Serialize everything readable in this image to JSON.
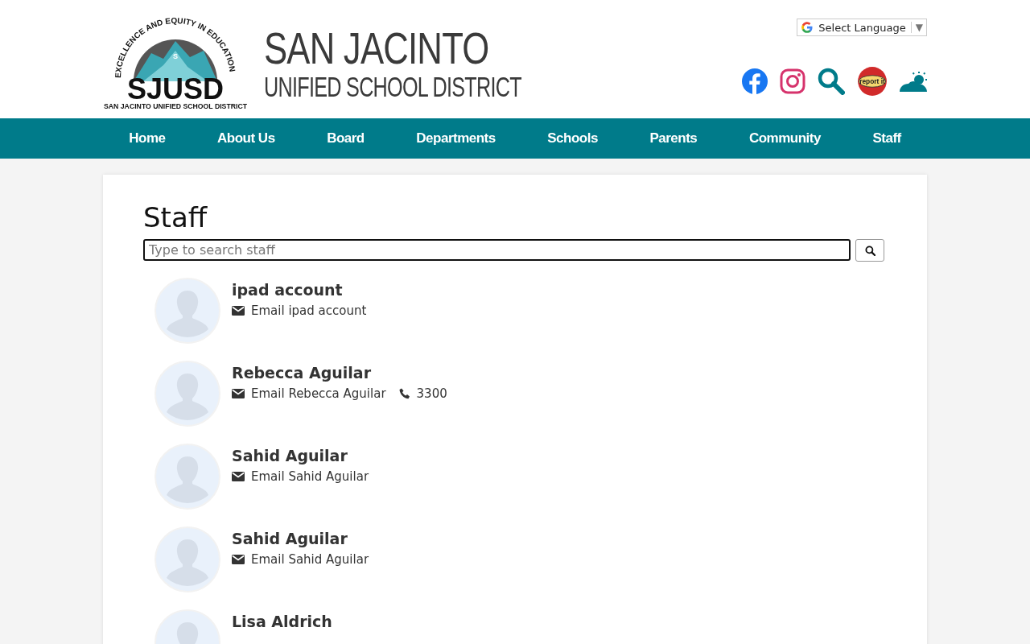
{
  "header": {
    "logo": {
      "arc_text": "EXCELLENCE AND EQUITY IN EDUCATION",
      "badge": "S",
      "wordmark": "SJUSD",
      "subtitle": "SAN JACINTO UNIFIED SCHOOL DISTRICT"
    },
    "title": "SAN JACINTO",
    "subtitle": "UNIFIED SCHOOL DISTRICT",
    "language": "Select Language",
    "language_caret": "▼",
    "report_label": "report it"
  },
  "nav": [
    {
      "label": "Home"
    },
    {
      "label": "About Us"
    },
    {
      "label": "Board"
    },
    {
      "label": "Departments"
    },
    {
      "label": "Schools"
    },
    {
      "label": "Parents"
    },
    {
      "label": "Community"
    },
    {
      "label": "Staff"
    }
  ],
  "page": {
    "title": "Staff",
    "search": {
      "placeholder": "Type to search staff"
    }
  },
  "staff": [
    {
      "name": "ipad account",
      "email": "Email ipad account"
    },
    {
      "name": "Rebecca Aguilar",
      "email": "Email Rebecca Aguilar",
      "phone": "3300"
    },
    {
      "name": "Sahid Aguilar",
      "email": "Email Sahid Aguilar"
    },
    {
      "name": "Sahid Aguilar",
      "email": "Email Sahid Aguilar"
    },
    {
      "name": "Lisa Aldrich"
    }
  ]
}
